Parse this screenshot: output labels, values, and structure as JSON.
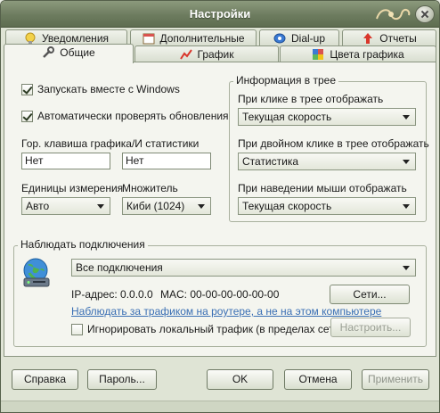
{
  "window": {
    "title": "Настройки"
  },
  "tabs_back": [
    {
      "label": "Уведомления",
      "icon": "lightbulb-icon"
    },
    {
      "label": "Дополнительные",
      "icon": "calendar-icon"
    },
    {
      "label": "Dial-up",
      "icon": "modem-icon"
    },
    {
      "label": "Отчеты",
      "icon": "report-icon"
    }
  ],
  "tabs_front": [
    {
      "label": "Общие",
      "icon": "tools-icon",
      "active": true
    },
    {
      "label": "График",
      "icon": "chart-icon"
    },
    {
      "label": "Цвета графика",
      "icon": "palette-icon"
    }
  ],
  "general": {
    "autostart_label": "Запускать вместе с Windows",
    "autostart_checked": true,
    "autoupdate_label": "Автоматически проверять обновления",
    "autoupdate_checked": true,
    "hotkey_label": "Гор. клавиша графика/И статистики",
    "hotkey_graph_value": "Нет",
    "hotkey_stats_value": "Нет",
    "units_label": "Единицы измерения",
    "units_value": "Авто",
    "multiplier_label": "Множитель",
    "multiplier_value": "Киби (1024)"
  },
  "tray": {
    "group_title": "Информация в трее",
    "click_label": "При клике в трее отображать",
    "click_value": "Текущая скорость",
    "dblclick_label": "При двойном клике в трее отображать",
    "dblclick_value": "Статистика",
    "hover_label": "При наведении мыши отображать",
    "hover_value": "Текущая скорость"
  },
  "connections": {
    "group_title": "Наблюдать подключения",
    "selected": "Все подключения",
    "ip_text": "IP-адрес: 0.0.0.0",
    "mac_text": "MAC: 00-00-00-00-00-00",
    "networks_button": "Сети...",
    "router_link": "Наблюдать за трафиком на роутере, а не на этом компьютере",
    "ignore_local_label": "Игнорировать локальный трафик (в пределах сети",
    "ignore_local_checked": false,
    "configure_button": "Настроить..."
  },
  "buttons": {
    "help": "Справка",
    "password": "Пароль...",
    "ok": "OK",
    "cancel": "Отмена",
    "apply": "Применить"
  }
}
